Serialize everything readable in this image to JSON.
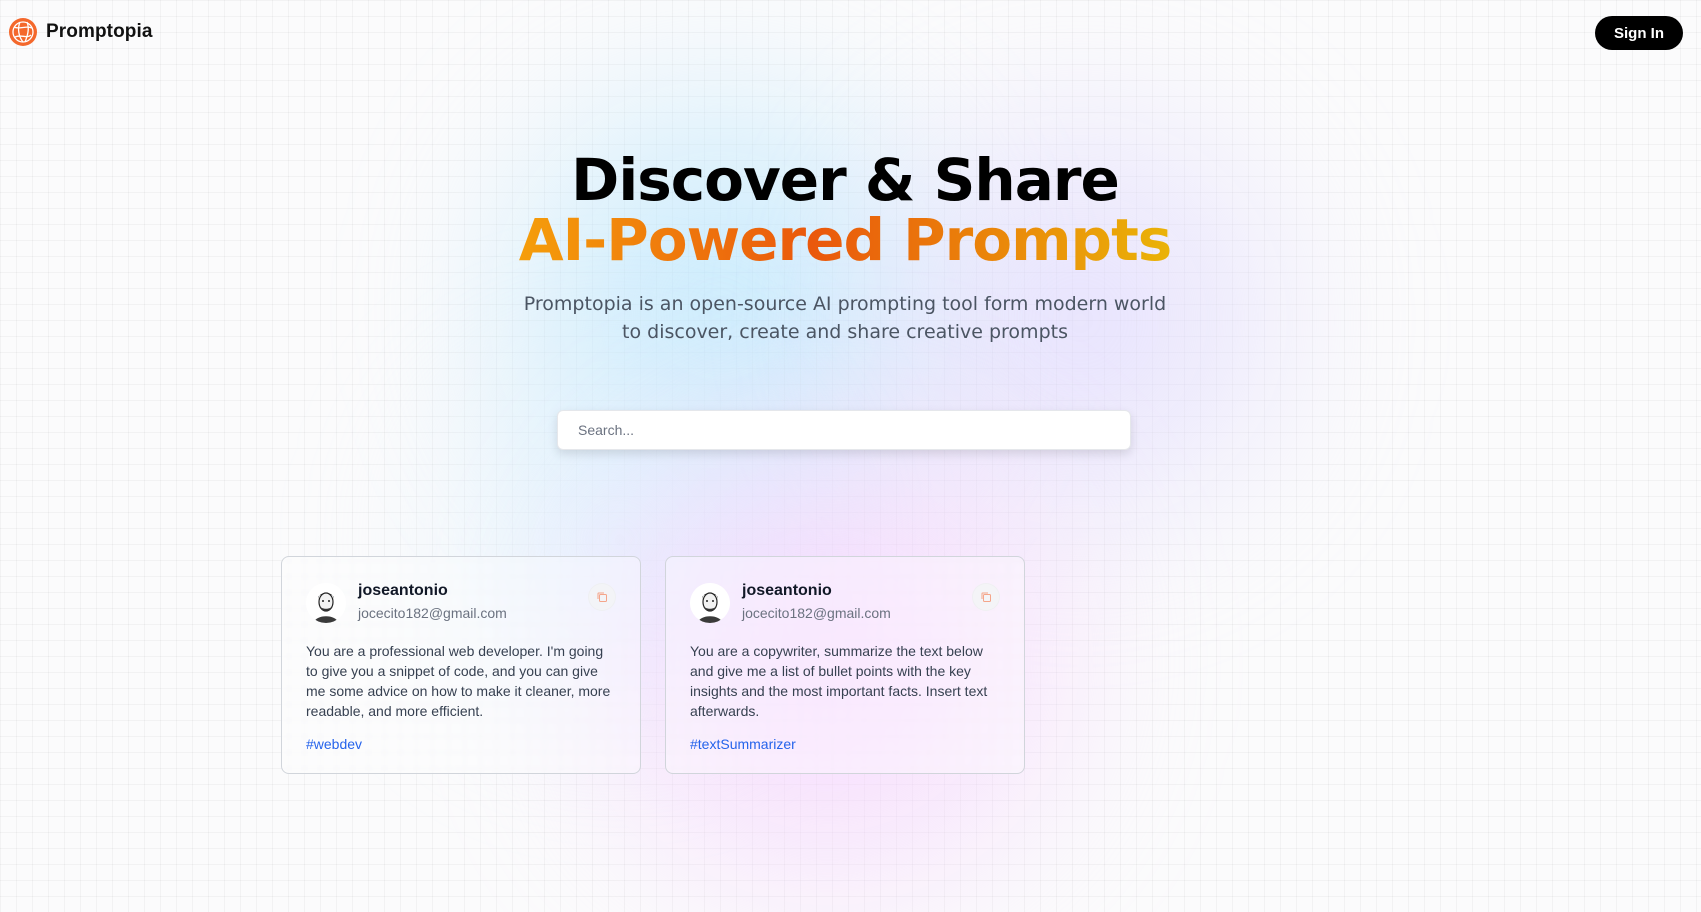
{
  "nav": {
    "brand": "Promptopia",
    "signin_label": "Sign In"
  },
  "hero": {
    "title_line1": "Discover & Share",
    "title_line2": "AI-Powered Prompts",
    "description": "Promptopia is an open-source AI prompting tool form modern world to discover, create and share creative prompts"
  },
  "search": {
    "placeholder": "Search...",
    "value": ""
  },
  "prompts": [
    {
      "username": "joseantonio",
      "email": "jocecito182@gmail.com",
      "text": "You are a professional web developer. I'm going to give you a snippet of code, and you can give me some advice on how to make it cleaner, more readable, and more efficient.",
      "tag": "#webdev"
    },
    {
      "username": "joseantonio",
      "email": "jocecito182@gmail.com",
      "text": "You are a copywriter, summarize the text below and give me a list of bullet points with the key insights and the most important facts. Insert text afterwards.",
      "tag": "#textSummarizer"
    }
  ],
  "icons": {
    "logo": "globe-logo-icon",
    "copy": "copy-icon",
    "avatar": "user-avatar"
  },
  "colors": {
    "accent_orange": "#ea580c",
    "accent_amber": "#f59e0b",
    "tag_blue": "#2563eb",
    "button_black": "#000000"
  }
}
